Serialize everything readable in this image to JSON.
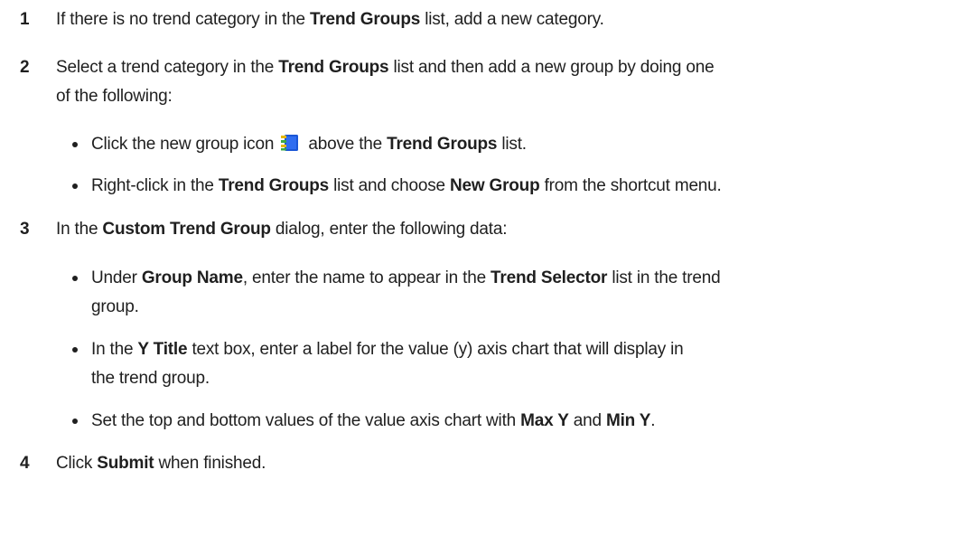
{
  "steps": [
    {
      "num": "1",
      "text": {
        "a": "If there is no trend category in the ",
        "b": "Trend Groups",
        "c": " list, add a new category."
      }
    },
    {
      "num": "2",
      "text": {
        "a": "Select a trend category in the ",
        "b": "Trend Groups",
        "c": " list and then add a new group by doing one",
        "d": "of the following:"
      },
      "bullets": [
        {
          "a": "Click the new group icon ",
          "icon": "new-group-icon",
          "b": " above the ",
          "c": "Trend Groups",
          "d": " list."
        },
        {
          "a": "Right-click in the ",
          "b": "Trend Groups",
          "c": " list and choose ",
          "d": "New Group",
          "e": " from the shortcut menu."
        }
      ]
    },
    {
      "num": "3",
      "text": {
        "a": "In the ",
        "b": "Custom Trend Group",
        "c": " dialog, enter the following data:"
      },
      "bullets": [
        {
          "a": "Under ",
          "b": "Group Name",
          "c": ", enter the name to appear in the ",
          "d": "Trend Selector",
          "e": " list in the trend",
          "f": "group."
        },
        {
          "a": "In the ",
          "b": "Y Title",
          "c": " text box, enter a label for the value (y) axis chart that will display in",
          "d": "the trend group."
        },
        {
          "a": "Set the top and bottom values of the value axis chart with ",
          "b": "Max Y",
          "c": " and ",
          "d": "Min Y",
          "e": "."
        }
      ]
    },
    {
      "num": "4",
      "text": {
        "a": "Click ",
        "b": "Submit",
        "c": " when finished."
      }
    }
  ],
  "colors": {
    "text": "#1f1f1f",
    "icon_blue": "#1a56d6",
    "icon_green": "#3aa845",
    "icon_yellow": "#e6b800"
  }
}
